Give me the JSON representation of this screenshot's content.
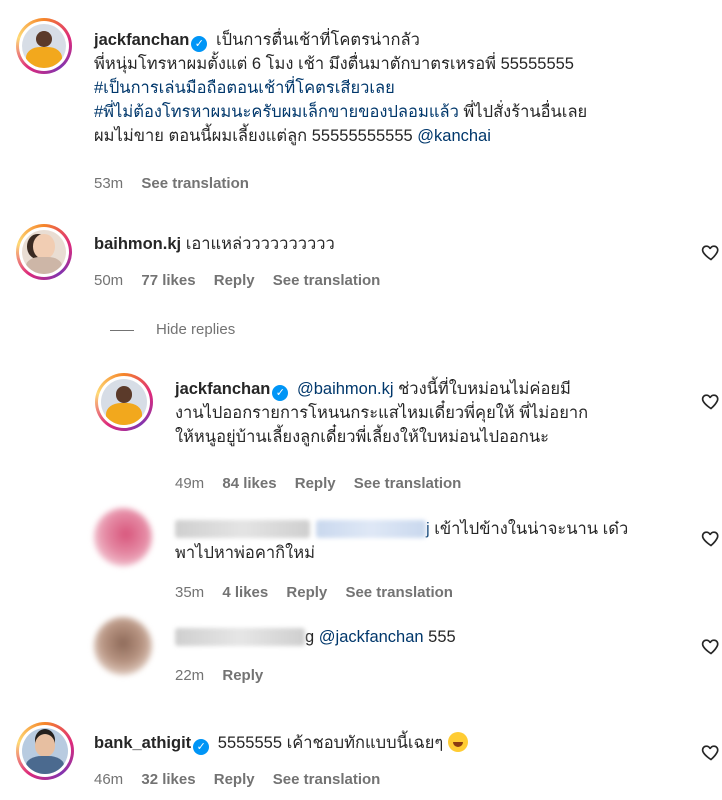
{
  "comments": [
    {
      "username": "jackfanchan",
      "verified": true,
      "line1": "เป็นการตื่นเช้าที่โคตรน่ากลัว",
      "line2": "พี่หนุ่มโทรหาผมตั้งแต่ 6 โมง เช้า มึงตื่นมาตักบาตรเหรอพี่ 55555555",
      "hashtag1": "#เป็นการเล่นมือถือตอนเช้าที่โคตรเสียวเลย",
      "hashtag2": "#พี่ไม่ต้องโทรหาผมนะครับผมเล็กขายของปลอมแล้ว",
      "line4_tail": " พี่ไปสั่งร้านอื่นเลย",
      "line5": "ผมไม่ขาย ตอนนี้ผมเลี้ยงแต่ลูก 55555555555 ",
      "mention": "@kanchai",
      "time": "53m",
      "see_translation": "See translation"
    },
    {
      "username": "baihmon.kj",
      "text": "เอาแหล่วววววววววว",
      "time": "50m",
      "likes": "77 likes",
      "reply": "Reply",
      "see_translation": "See translation"
    }
  ],
  "hide_replies": "Hide replies",
  "replies": [
    {
      "username": "jackfanchan",
      "verified": true,
      "mention": "@baihmon.kj",
      "line1": " ช่วงนี้ที่ใบหม่อนไม่ค่อยมี",
      "line2": "งานไปออกรายการโหนนกระแสไหมเดี๋ยวพี่คุยให้ พี่ไม่อยาก",
      "line3": "ให้หนูอยู่บ้านเลี้ยงลูกเดี๋ยวพี่เลี้ยงให้ใบหม่อนไปออกนะ",
      "time": "49m",
      "likes": "84 likes",
      "reply": "Reply",
      "see_translation": "See translation"
    },
    {
      "username_suffix": "j",
      "line1": " เข้าไปข้างในน่าจะนาน เด๋ว",
      "line2": "พาไปหาพ่อคากิใหม่",
      "time": "35m",
      "likes": "4 likes",
      "reply": "Reply",
      "see_translation": "See translation"
    },
    {
      "username_suffix": "g",
      "mention": "@jackfanchan",
      "text": " 555",
      "time": "22m",
      "reply": "Reply"
    }
  ],
  "last_comment": {
    "username": "bank_athigit",
    "verified": true,
    "text": "5555555 เค้าชอบทักแบบนี้เฉยๆ",
    "emoji": "laughing-tears-emoji",
    "time": "46m",
    "likes": "32 likes",
    "reply": "Reply",
    "see_translation": "See translation"
  },
  "icons": {
    "like": "heart-outline-icon",
    "verified": "verified-badge-icon"
  },
  "colors": {
    "verified": "#0095f6",
    "link": "#00376b",
    "meta": "#737373",
    "text": "#262626"
  }
}
